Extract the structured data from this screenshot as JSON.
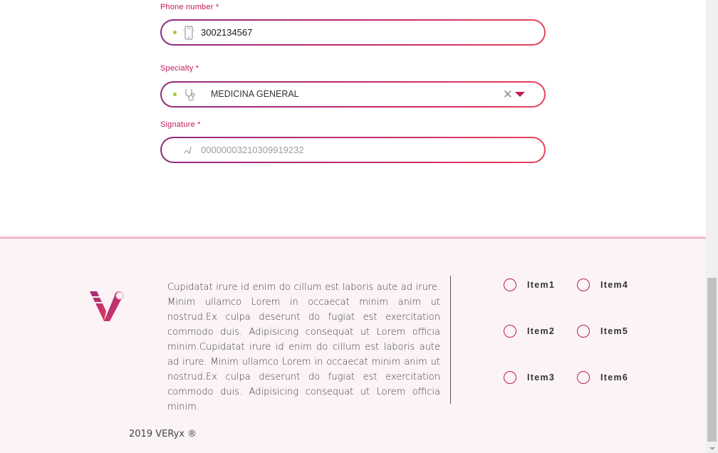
{
  "form": {
    "phone": {
      "label": "Phone number *",
      "value": "3002134567",
      "icon": "mobile-phone-icon"
    },
    "specialty": {
      "label": "Specialty *",
      "value": "MEDICINA GENERAL",
      "icon": "stethoscope-icon",
      "clear_glyph": "✕"
    },
    "signature": {
      "label": "Signature *",
      "value": "00000003210309919232",
      "icon": "signature-icon"
    }
  },
  "footer": {
    "logo": "veryx-logo",
    "text": "Cupidatat irure id enim do cillum est laboris aute ad irure. Minim ullamco Lorem in occaecat minim anim ut nostrud.Ex culpa deserunt do fugiat est exercitation commodo duis. Adipisicing consequat ut Lorem officia minim.Cupidatat irure id enim do cillum est laboris aute ad irure. Minim ullamco Lorem in occaecat minim anim ut nostrud.Ex culpa deserunt do fugiat est exercitation commodo duis. Adipisicing consequat ut Lorem officia minim.",
    "items": [
      {
        "label": "Item1"
      },
      {
        "label": "Item2"
      },
      {
        "label": "Item3"
      },
      {
        "label": "Item4"
      },
      {
        "label": "Item5"
      },
      {
        "label": "Item6"
      }
    ],
    "copyright": "2019 VERyx ®"
  },
  "colors": {
    "accent": "#c2185b",
    "gradient_start": "#8e2c7f",
    "gradient_end": "#e6455a",
    "status_dot": "#9ccc3a",
    "footer_bg": "#fbf3f6"
  }
}
